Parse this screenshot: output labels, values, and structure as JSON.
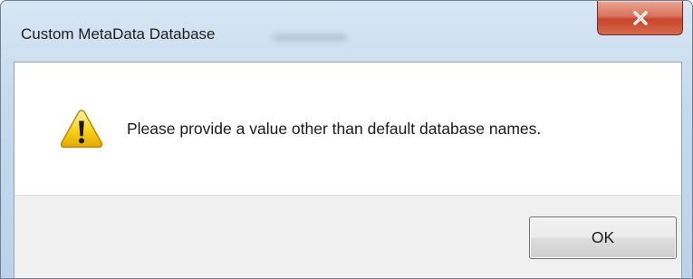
{
  "window": {
    "title": "Custom MetaData Database",
    "close_icon": "close-icon",
    "close_color": "#c7452c"
  },
  "message": {
    "icon": "warning-icon",
    "icon_color": "#f2c200",
    "text": "Please provide a value other than default database names."
  },
  "buttons": {
    "ok_label": "OK"
  }
}
